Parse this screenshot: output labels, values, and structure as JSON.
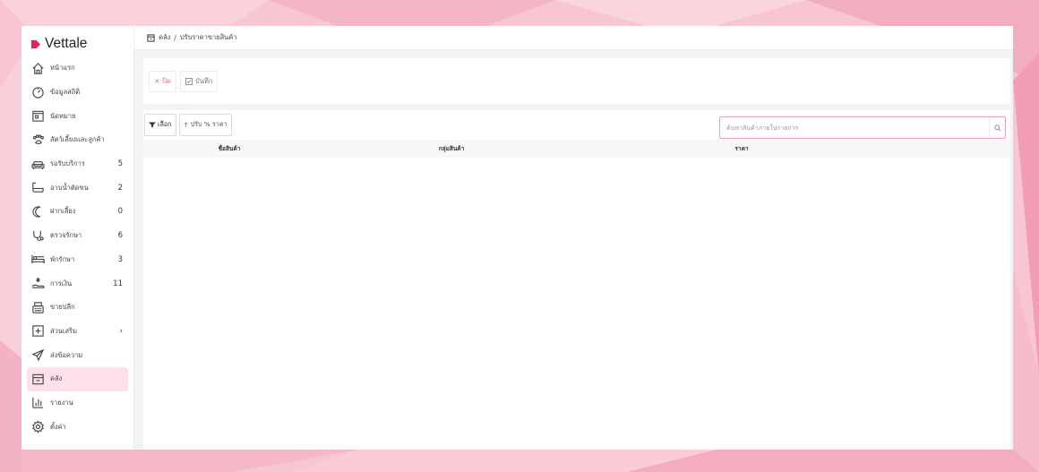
{
  "brand": {
    "name": "Vettale",
    "accent": "#e91e63"
  },
  "sidebar": {
    "items": [
      {
        "label": "หน้าแรก",
        "count": "",
        "icon": "home-icon"
      },
      {
        "label": "ข้อมูลสถิติ",
        "count": "",
        "icon": "dashboard-icon"
      },
      {
        "label": "นัดหมาย",
        "count": "",
        "icon": "calendar-icon"
      },
      {
        "label": "สัตว์เลี้ยงและลูกค้า",
        "count": "",
        "icon": "paw-icon"
      },
      {
        "label": "รอรับบริการ",
        "count": "5",
        "icon": "sofa-icon"
      },
      {
        "label": "อาบน้ำตัดขน",
        "count": "2",
        "icon": "bathtub-icon"
      },
      {
        "label": "ฝากเลี้ยง",
        "count": "0",
        "icon": "moon-icon"
      },
      {
        "label": "ตรวจรักษา",
        "count": "6",
        "icon": "stethoscope-icon"
      },
      {
        "label": "พักรักษา",
        "count": "3",
        "icon": "bed-icon"
      },
      {
        "label": "การเงิน",
        "count": "11",
        "icon": "money-hand-icon"
      },
      {
        "label": "ขายปลีก",
        "count": "",
        "icon": "cash-register-icon"
      },
      {
        "label": "ส่วนเสริม",
        "count": "›",
        "icon": "plus-square-icon"
      },
      {
        "label": "ส่งข้อความ",
        "count": "",
        "icon": "send-icon"
      },
      {
        "label": "คลัง",
        "count": "",
        "icon": "inventory-box-icon",
        "active": true
      },
      {
        "label": "รายงาน",
        "count": "",
        "icon": "bar-chart-icon"
      },
      {
        "label": "ตั้งค่า",
        "count": "",
        "icon": "gear-icon"
      }
    ]
  },
  "breadcrumb": {
    "root": "คลัง",
    "separator": "/",
    "current": "ปรับราคาขายสินค้า"
  },
  "toolbar": {
    "close_label": "ปิด",
    "save_label": "บันทึก"
  },
  "controls": {
    "select_label": "เลือก",
    "adjust_label": "ปรับ % ราคา",
    "search_placeholder": "ค้นหาสินค้าภายในรายการ"
  },
  "table": {
    "columns": [
      "ชื่อสินค้า",
      "กลุ่มสินค้า",
      "ราคา"
    ],
    "rows": []
  },
  "colors": {
    "active_bg": "#fde0ea",
    "search_border": "#e9a0bd",
    "close_text": "#e06a8f"
  }
}
